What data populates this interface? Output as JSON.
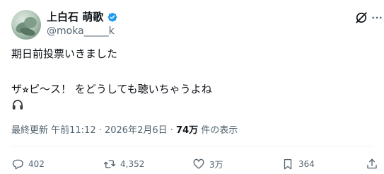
{
  "author": {
    "display_name": "上白石 萌歌",
    "handle": "@moka_____k",
    "verified": true
  },
  "post": {
    "line1": "期日前投票いきました",
    "line2": "ザ⭐︎ピ〜ス！ をどうしても聴いちゃうよね"
  },
  "meta": {
    "prefix": "最終更新 午前11:12 · 2026年2月6日 · ",
    "views": "74万",
    "suffix": " 件の表示"
  },
  "actions": {
    "reply_count": "402",
    "repost_count": "4,352",
    "like_count": "3万",
    "views_count": "364"
  },
  "colors": {
    "text": "#0f1419",
    "secondary": "#536471",
    "verified_blue": "#1d9bf0",
    "divider": "#eff3f4"
  },
  "icons": [
    "verified-badge-icon",
    "grok-icon",
    "more-icon",
    "headphones-icon",
    "reply-icon",
    "repost-icon",
    "like-icon",
    "views-icon",
    "bookmark-icon"
  ]
}
